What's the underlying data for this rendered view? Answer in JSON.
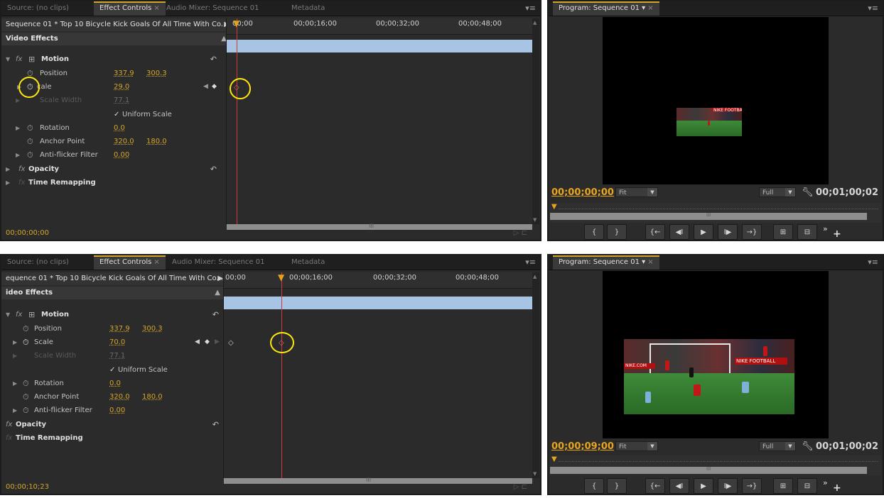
{
  "panels": {
    "ec_tabs": [
      {
        "label": "Source: (no clips)"
      },
      {
        "label": "Effect Controls"
      },
      {
        "label": "Audio Mixer: Sequence 01"
      },
      {
        "label": "Metadata"
      }
    ],
    "program_tab": "Program: Sequence 01",
    "close_glyph": "×",
    "menu_glyph": "▾≡"
  },
  "effect_controls": {
    "sequence_label": "Sequence 01 * Top 10 Bicycle Kick Goals Of All Time With Co...",
    "sequence_label_bottom": "equence 01 * Top 10 Bicycle Kick Goals Of All Time With Co...",
    "video_effects": "Video Effects",
    "video_effects_bottom": "ideo Effects",
    "motion": "Motion",
    "position": {
      "label": "Position",
      "x": "337.9",
      "y": "300.3"
    },
    "scale_label": "Scale",
    "scale_label_top": "cale",
    "scale_width": {
      "label": "Scale Width",
      "value": "77.1"
    },
    "uniform_scale": "Uniform Scale",
    "rotation": {
      "label": "Rotation",
      "value": "0.0"
    },
    "anchor_point": {
      "label": "Anchor Point",
      "x": "320.0",
      "y": "180.0"
    },
    "anti_flicker": {
      "label": "Anti-flicker Filter",
      "value": "0.00"
    },
    "opacity": "Opacity",
    "time_remapping": "Time Remapping"
  },
  "top": {
    "scale_value": "29.0",
    "timecode": "00;00;00;00",
    "ruler": [
      "00;00",
      "00;00;16;00",
      "00;00;32;00",
      "00;00;48;00"
    ],
    "program_timecode": "00;00;00;00",
    "playhead_fraction": 0.0
  },
  "bottom": {
    "scale_value": "70.0",
    "timecode": "00;00;10;23",
    "ruler": [
      "00;00",
      "00;00;16;00",
      "00;00;32;00",
      "00;00;48;00"
    ],
    "program_timecode": "00;00;09;00",
    "playhead_fraction": 0.18
  },
  "monitor": {
    "fit": "Fit",
    "full": "Full",
    "duration": "00;01;00;02",
    "video_ad": "NIKE FOOTBALL",
    "video_ad2": "NIKE.COM"
  },
  "transport": [
    "{",
    "}",
    "{←",
    "◀I",
    "▶",
    "I▶",
    "→}",
    "⊞",
    "⊟"
  ],
  "transport_more": "»",
  "transport_plus": "+",
  "colors": {
    "accent": "#d4a52c",
    "playhead": "#d23a3a",
    "highlight_circle": "#ffe70b",
    "clip_bar": "#a8c4e4"
  },
  "icons": {
    "stopwatch": "stopwatch-icon",
    "reset": "reset-icon",
    "wrench": "wrench-icon",
    "fx": "fx-badge-icon",
    "keyframe": "keyframe-diamond-icon"
  }
}
